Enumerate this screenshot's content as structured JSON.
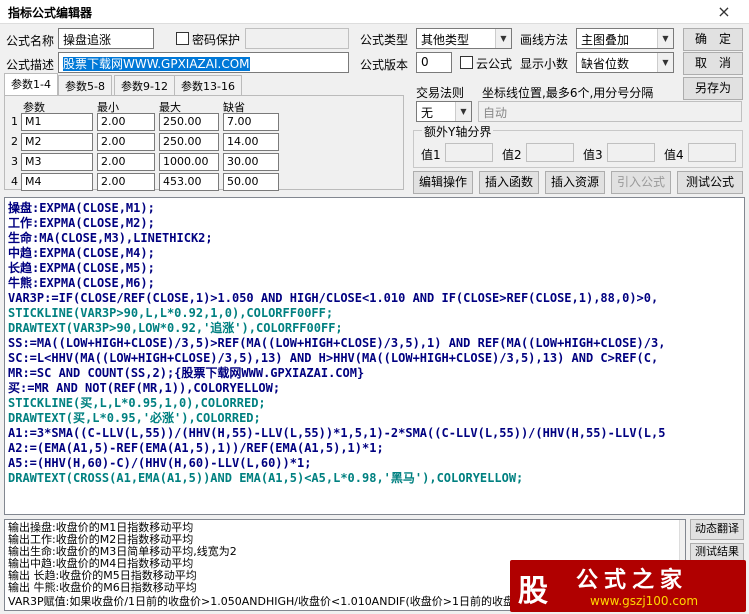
{
  "window": {
    "title": "指标公式编辑器",
    "close": "×"
  },
  "form": {
    "name_label": "公式名称",
    "name_value": "操盘追涨",
    "password_label": "密码保护",
    "desc_label": "公式描述",
    "desc_value": "股票下载网WWW.GPXIAZAI.COM",
    "type_label": "公式类型",
    "type_value": "其他类型",
    "draw_label": "画线方法",
    "draw_value": "主图叠加",
    "version_label": "公式版本",
    "version_value": "0",
    "cloud_label": "云公式",
    "decimal_label": "显示小数",
    "decimal_value": "缺省位数",
    "trade_label": "交易法则",
    "trade_value": "无",
    "axis_label": "坐标线位置,最多6个,用分号分隔",
    "axis_value": "自动",
    "extra_axis_label": "额外Y轴分界",
    "val_labels": [
      "值1",
      "值2",
      "值3",
      "值4"
    ]
  },
  "buttons": {
    "ok": "确　定",
    "cancel": "取　消",
    "save_as": "另存为",
    "edit_op": "编辑操作",
    "insert_func": "插入函数",
    "insert_res": "插入资源",
    "import_formula": "引入公式",
    "test_formula": "测试公式",
    "dynamic_translate": "动态翻译",
    "test_result": "测试结果"
  },
  "tabs": [
    "参数1-4",
    "参数5-8",
    "参数9-12",
    "参数13-16"
  ],
  "params": {
    "headers": [
      "参数",
      "最小",
      "最大",
      "缺省"
    ],
    "rows": [
      {
        "idx": "1",
        "name": "M1",
        "min": "2.00",
        "max": "250.00",
        "def": "7.00"
      },
      {
        "idx": "2",
        "name": "M2",
        "min": "2.00",
        "max": "250.00",
        "def": "14.00"
      },
      {
        "idx": "3",
        "name": "M3",
        "min": "2.00",
        "max": "1000.00",
        "def": "30.00"
      },
      {
        "idx": "4",
        "name": "M4",
        "min": "2.00",
        "max": "453.00",
        "def": "50.00"
      }
    ]
  },
  "code": [
    "操盘:EXPMA(CLOSE,M1);",
    "工作:EXPMA(CLOSE,M2);",
    "生命:MA(CLOSE,M3),LINETHICK2;",
    "中趋:EXPMA(CLOSE,M4);",
    "长趋:EXPMA(CLOSE,M5);",
    "牛熊:EXPMA(CLOSE,M6);",
    "VAR3P:=IF(CLOSE/REF(CLOSE,1)>1.050 AND HIGH/CLOSE<1.010 AND IF(CLOSE>REF(CLOSE,1),88,0)>0,",
    "STICKLINE(VAR3P>90,L,L*0.92,1,0),COLORFF00FF;",
    "DRAWTEXT(VAR3P>90,LOW*0.92,'追涨'),COLORFF00FF;",
    "SS:=MA((LOW+HIGH+CLOSE)/3,5)>REF(MA((LOW+HIGH+CLOSE)/3,5),1) AND REF(MA((LOW+HIGH+CLOSE)/3,",
    "SC:=L<HHV(MA((LOW+HIGH+CLOSE)/3,5),13) AND H>HHV(MA((LOW+HIGH+CLOSE)/3,5),13) AND C>REF(C,",
    "MR:=SC AND COUNT(SS,2);{股票下载网WWW.GPXIAZAI.COM}",
    "买:=MR AND NOT(REF(MR,1)),COLORYELLOW;",
    "STICKLINE(买,L,L*0.95,1,0),COLORRED;",
    "DRAWTEXT(买,L*0.95,'必涨'),COLORRED;",
    "A1:=3*SMA((C-LLV(L,55))/(HHV(H,55)-LLV(L,55))*1,5,1)-2*SMA((C-LLV(L,55))/(HHV(H,55)-LLV(L,5",
    "A2:=(EMA(A1,5)-REF(EMA(A1,5),1))/REF(EMA(A1,5),1)*1;",
    "A5:=(HHV(H,60)-C)/(HHV(H,60)-LLV(L,60))*1;",
    "DRAWTEXT(CROSS(A1,EMA(A1,5))AND EMA(A1,5)<A5,L*0.98,'黑马'),COLORYELLOW;"
  ],
  "output": [
    "输出操盘:收盘价的M1日指数移动平均",
    "输出工作:收盘价的M2日指数移动平均",
    "输出生命:收盘价的M3日简单移动平均,线宽为2",
    "输出中趋:收盘价的M4日指数移动平均",
    "输出 长趋:收盘价的M5日指数移动平均",
    "输出 牛熊:收盘价的M6日指数移动平均",
    "VAR3P赋值:如果收盘价/1日前的收盘价>1.050ANDHIGH/收盘价<1.010ANDIF(收盘价>1日前的收盘"
  ],
  "watermark": {
    "logo": "股",
    "brand": "公式之家",
    "url": "www.gszj100.com"
  }
}
